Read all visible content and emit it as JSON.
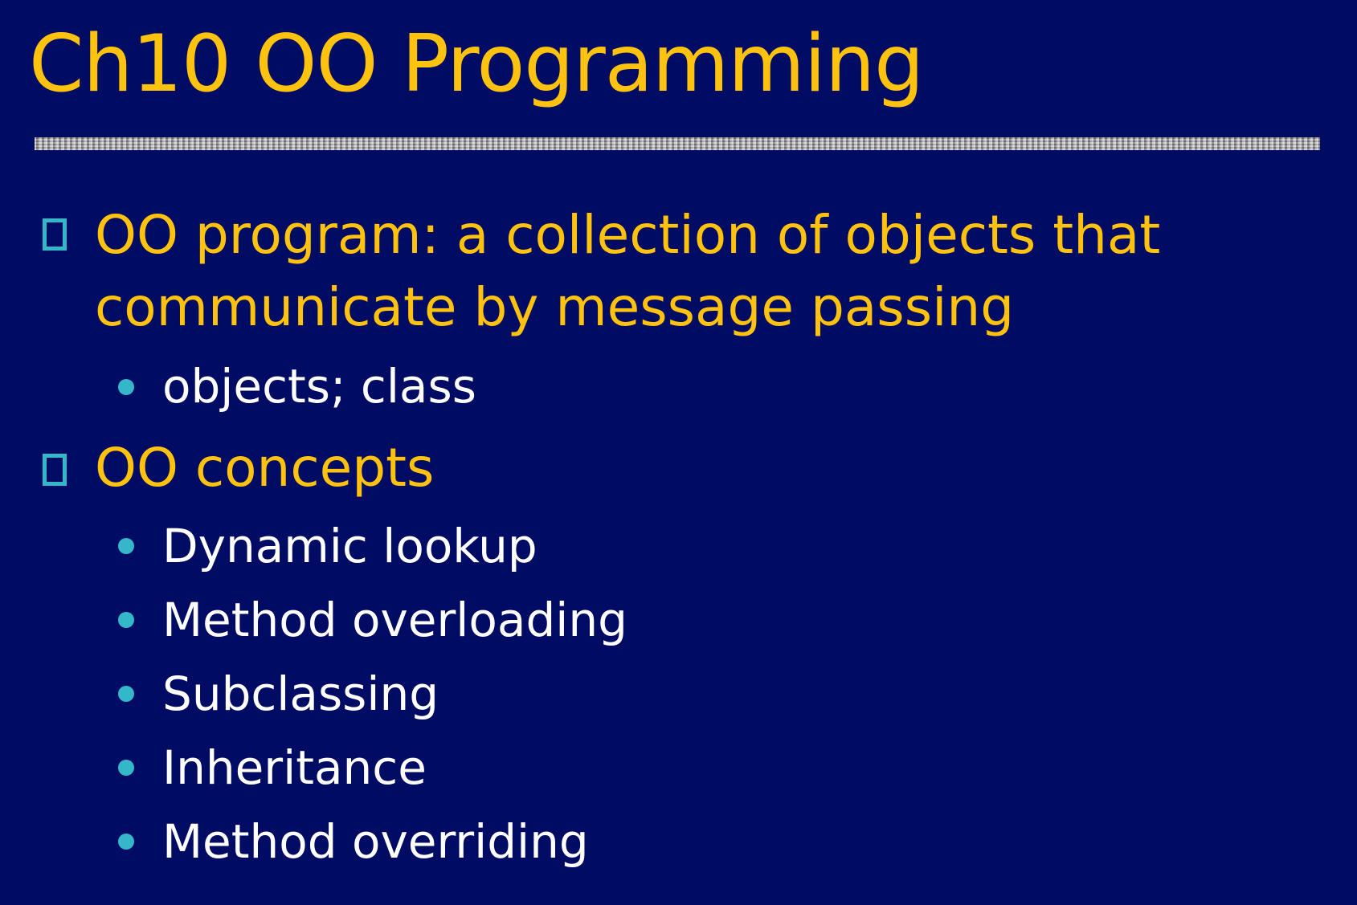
{
  "slide": {
    "title": "Ch10 OO Programming",
    "bullets": [
      {
        "text_line1": "OO program: a collection of objects that",
        "text_line2": "communicate by message passing",
        "subitems": [
          "objects; class"
        ]
      },
      {
        "text_line1": "OO concepts",
        "subitems": [
          "Dynamic lookup",
          "Method overloading",
          "Subclassing",
          "Inheritance",
          "Method overriding"
        ]
      }
    ]
  },
  "colors": {
    "background": "#000C63",
    "title": "#FFC20E",
    "level1_text": "#FFC20E",
    "level2_text": "#FFFFFF",
    "bullet_marker": "#33B7C9"
  },
  "icons": {
    "level1_bullet": "hollow-square-icon",
    "level2_bullet": "filled-circle-icon"
  }
}
